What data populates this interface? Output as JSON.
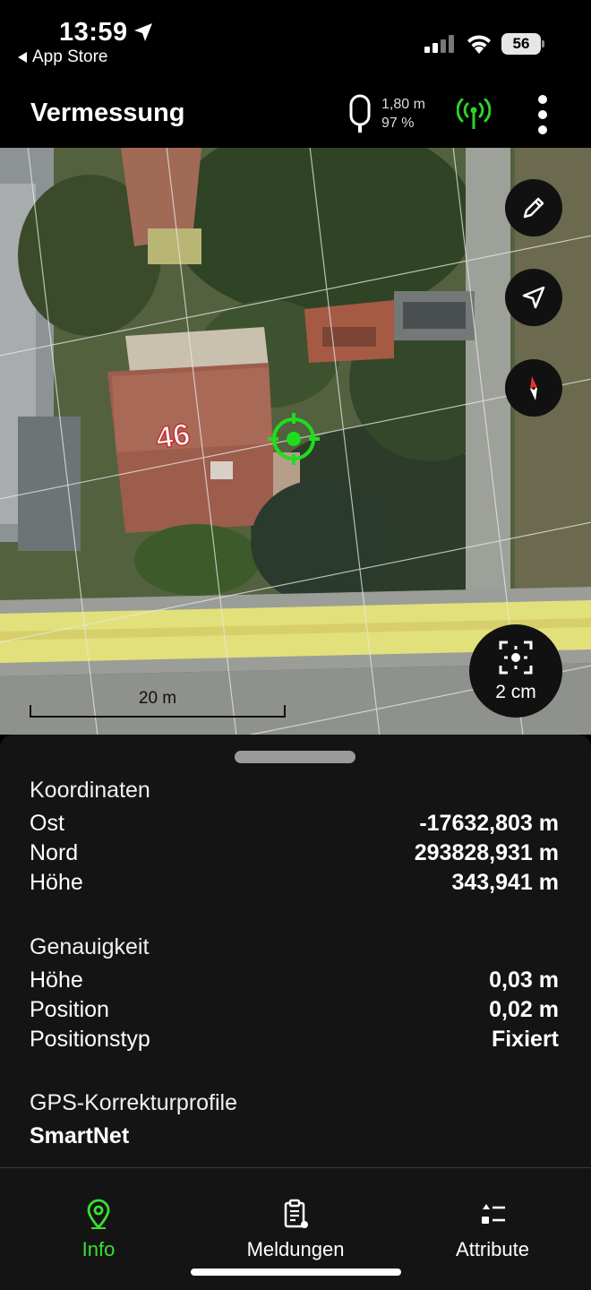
{
  "status_bar": {
    "time": "13:59",
    "back_label": "App Store",
    "battery": "56"
  },
  "header": {
    "title": "Vermessung",
    "device_height": "1,80 m",
    "device_battery": "97 %",
    "antenna_color": "#2bd42b"
  },
  "map": {
    "scale_label": "20 m",
    "accuracy_label": "2 cm",
    "house_number": "46",
    "marker_color": "#1fdc1f"
  },
  "coordinates": {
    "title": "Koordinaten",
    "rows": [
      {
        "label": "Ost",
        "value": "-17632,803 m"
      },
      {
        "label": "Nord",
        "value": "293828,931 m"
      },
      {
        "label": "Höhe",
        "value": "343,941 m"
      }
    ]
  },
  "accuracy": {
    "title": "Genauigkeit",
    "rows": [
      {
        "label": "Höhe",
        "value": "0,03 m"
      },
      {
        "label": "Position",
        "value": "0,02 m"
      },
      {
        "label": "Positionstyp",
        "value": "Fixiert"
      }
    ]
  },
  "correction": {
    "title": "GPS-Korrekturprofile",
    "value": "SmartNet"
  },
  "tabs": [
    {
      "label": "Info",
      "icon": "map-pin-icon",
      "active": true
    },
    {
      "label": "Meldungen",
      "icon": "clipboard-icon",
      "active": false
    },
    {
      "label": "Attribute",
      "icon": "list-icon",
      "active": false
    }
  ],
  "colors": {
    "accent": "#39e130",
    "sheet_bg": "#141414"
  }
}
